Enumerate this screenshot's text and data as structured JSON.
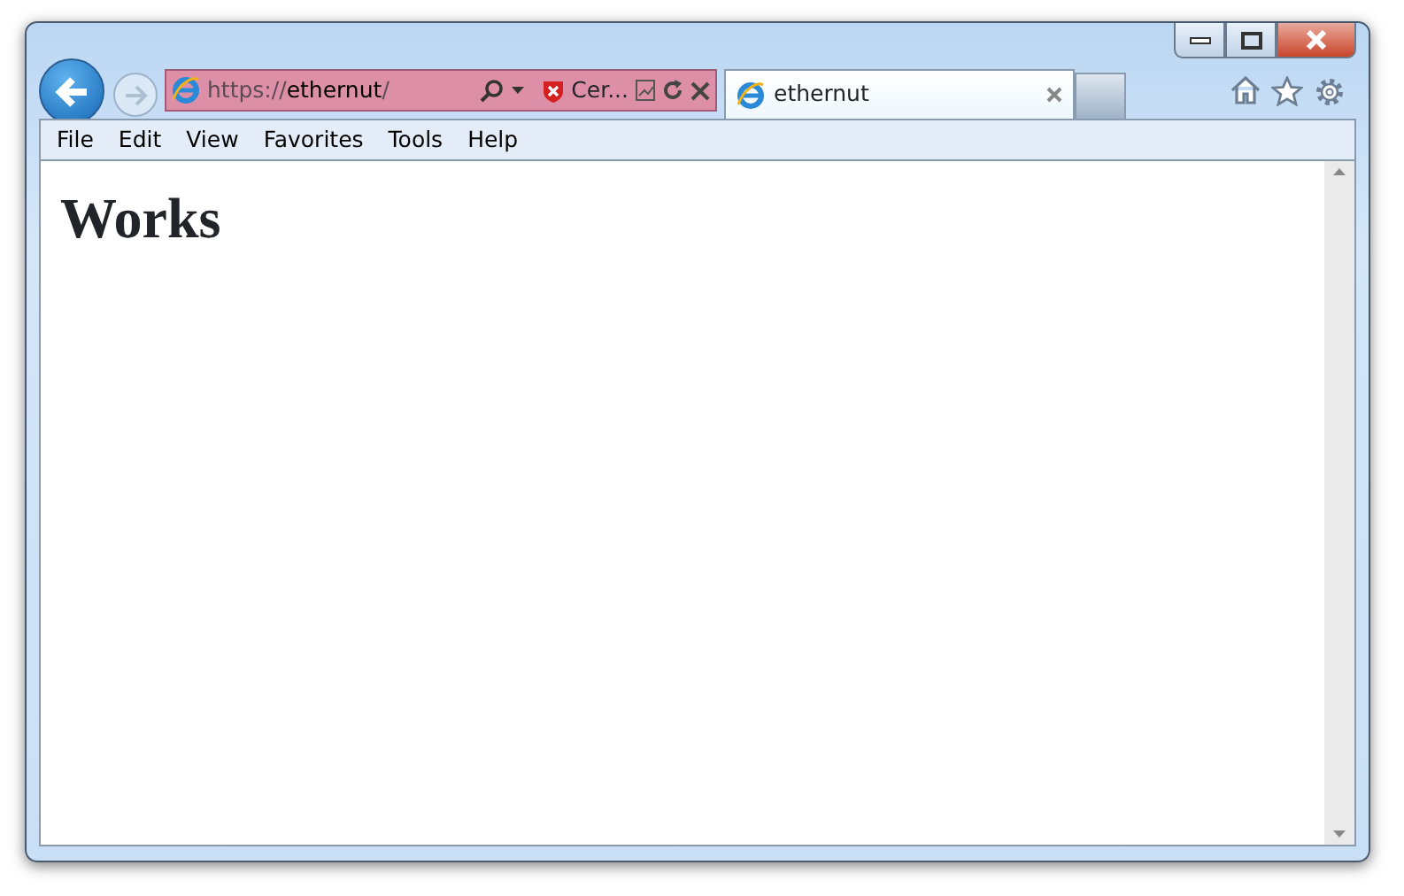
{
  "address_bar": {
    "scheme": "https://",
    "host": "ethernut",
    "path": "/",
    "certificate_error": true,
    "certificate_label": "Cer..."
  },
  "tabs": [
    {
      "title": "ethernut",
      "selected": true
    }
  ],
  "menu": [
    "File",
    "Edit",
    "View",
    "Favorites",
    "Tools",
    "Help"
  ],
  "page": {
    "heading": "Works"
  }
}
